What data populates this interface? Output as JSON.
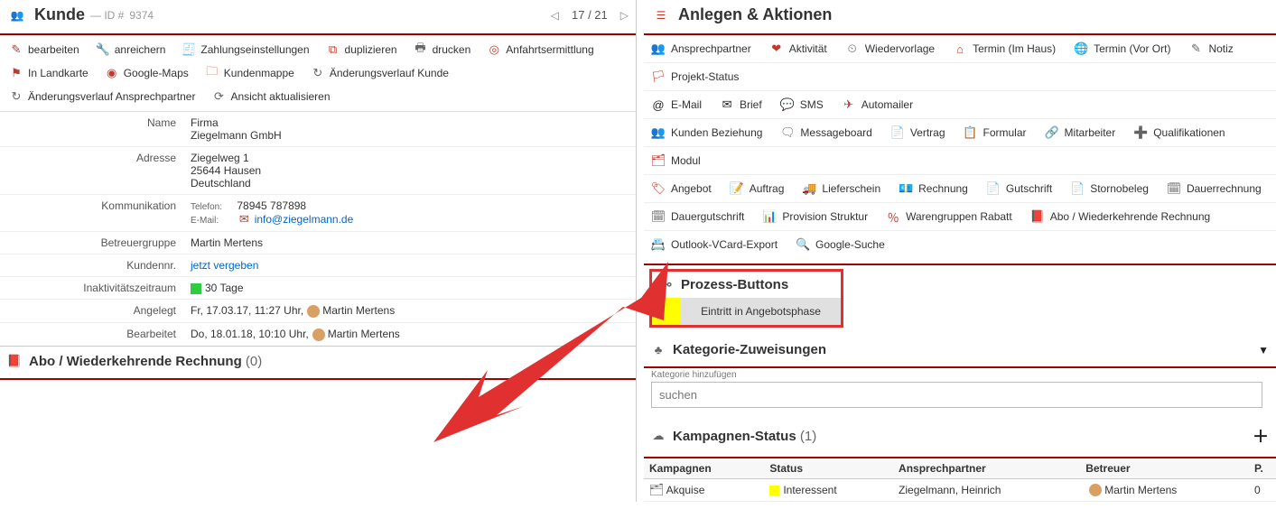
{
  "left": {
    "title": "Kunde",
    "id_prefix": "— ID #",
    "id": "9374",
    "pager": {
      "pos": "17 / 21"
    },
    "toolbar": [
      {
        "icon": "✎",
        "cls": "ic-red",
        "name": "edit",
        "label": "bearbeiten"
      },
      {
        "icon": "🔧",
        "cls": "ic-grey",
        "name": "enrich",
        "label": "anreichern"
      },
      {
        "icon": "🧾",
        "cls": "ic-red",
        "name": "payment-settings",
        "label": "Zahlungseinstellungen"
      },
      {
        "icon": "⧉",
        "cls": "ic-red",
        "name": "duplicate",
        "label": "duplizieren"
      },
      {
        "icon": "🖶",
        "cls": "ic-grey",
        "name": "print",
        "label": "drucken"
      },
      {
        "icon": "◎",
        "cls": "ic-red",
        "name": "route",
        "label": "Anfahrtsermittlung"
      },
      {
        "icon": "⚑",
        "cls": "ic-red",
        "name": "map",
        "label": "In Landkarte"
      },
      {
        "icon": "◉",
        "cls": "ic-red",
        "name": "gmaps",
        "label": "Google-Maps"
      },
      {
        "icon": "🗀",
        "cls": "ic-red",
        "name": "folder",
        "label": "Kundenmappe"
      },
      {
        "icon": "↻",
        "cls": "ic-grey",
        "name": "history-customer",
        "label": "Änderungsverlauf Kunde"
      },
      {
        "icon": "↻",
        "cls": "ic-grey",
        "name": "history-contact",
        "label": "Änderungsverlauf Ansprechpartner"
      },
      {
        "icon": "⟳",
        "cls": "ic-grey",
        "name": "refresh",
        "label": "Ansicht aktualisieren"
      }
    ],
    "fields": {
      "name_label": "Name",
      "name_line1": "Firma",
      "name_line2": "Ziegelmann GmbH",
      "addr_label": "Adresse",
      "addr_line1": "Ziegelweg 1",
      "addr_line2": "25644 Hausen",
      "addr_line3": "Deutschland",
      "comm_label": "Kommunikation",
      "phone_lbl": "Telefon:",
      "phone": "78945 787898",
      "email_lbl": "E-Mail:",
      "email": "info@ziegelmann.de",
      "group_label": "Betreuergruppe",
      "group": "Martin Mertens",
      "custno_label": "Kundennr.",
      "custno": "jetzt vergeben",
      "inact_label": "Inaktivitätszeitraum",
      "inact": "30 Tage",
      "created_label": "Angelegt",
      "created": "Fr, 17.03.17, 11:27 Uhr,",
      "created_by": "Martin Mertens",
      "edited_label": "Bearbeitet",
      "edited": "Do, 18.01.18, 10:10 Uhr,",
      "edited_by": "Martin Mertens"
    },
    "abo": {
      "title": "Abo / Wiederkehrende Rechnung",
      "count": "(0)"
    }
  },
  "right": {
    "title": "Anlegen & Aktionen",
    "row1": [
      {
        "icon": "👥",
        "cls": "ic-red",
        "name": "contact",
        "label": "Ansprechpartner"
      },
      {
        "icon": "❤",
        "cls": "ic-red",
        "name": "activity",
        "label": "Aktivität"
      },
      {
        "icon": "⏲",
        "cls": "ic-grey",
        "name": "resub",
        "label": "Wiedervorlage"
      },
      {
        "icon": "⌂",
        "cls": "ic-red",
        "name": "appt-inhouse",
        "label": "Termin (Im Haus)"
      },
      {
        "icon": "🌐",
        "cls": "ic-red",
        "name": "appt-onsite",
        "label": "Termin (Vor Ort)"
      },
      {
        "icon": "✎",
        "cls": "ic-grey",
        "name": "note",
        "label": "Notiz"
      }
    ],
    "row2": [
      {
        "icon": "🏳",
        "cls": "ic-red",
        "name": "project-status",
        "label": "Projekt-Status"
      }
    ],
    "row3": [
      {
        "icon": "@",
        "cls": "ic-dark",
        "name": "email",
        "label": "E-Mail"
      },
      {
        "icon": "✉",
        "cls": "ic-dark",
        "name": "letter",
        "label": "Brief"
      },
      {
        "icon": "💬",
        "cls": "ic-red",
        "name": "sms",
        "label": "SMS"
      },
      {
        "icon": "✈",
        "cls": "ic-red",
        "name": "automailer",
        "label": "Automailer"
      }
    ],
    "row4": [
      {
        "icon": "👥",
        "cls": "ic-red",
        "name": "relation",
        "label": "Kunden Beziehung"
      },
      {
        "icon": "🗨",
        "cls": "ic-grey",
        "name": "msgboard",
        "label": "Messageboard"
      },
      {
        "icon": "📄",
        "cls": "ic-red",
        "name": "contract",
        "label": "Vertrag"
      },
      {
        "icon": "📋",
        "cls": "ic-red",
        "name": "form",
        "label": "Formular"
      },
      {
        "icon": "🔗",
        "cls": "ic-green",
        "name": "employee",
        "label": "Mitarbeiter",
        "hl": true
      },
      {
        "icon": "➕",
        "cls": "ic-dark",
        "name": "qualif",
        "label": "Qualifikationen"
      }
    ],
    "row5": [
      {
        "icon": "🗂",
        "cls": "ic-red",
        "name": "module",
        "label": "Modul"
      }
    ],
    "row6": [
      {
        "icon": "🏷",
        "cls": "ic-red",
        "name": "offer",
        "label": "Angebot"
      },
      {
        "icon": "📝",
        "cls": "ic-red",
        "name": "order",
        "label": "Auftrag"
      },
      {
        "icon": "🚚",
        "cls": "ic-grey",
        "name": "delivery",
        "label": "Lieferschein"
      },
      {
        "icon": "💶",
        "cls": "ic-red",
        "name": "invoice",
        "label": "Rechnung"
      },
      {
        "icon": "📄",
        "cls": "ic-red",
        "name": "credit",
        "label": "Gutschrift"
      },
      {
        "icon": "📄",
        "cls": "ic-red",
        "name": "cancel",
        "label": "Stornobeleg"
      },
      {
        "icon": "🗓",
        "cls": "ic-grey",
        "name": "recurring",
        "label": "Dauerrechnung"
      }
    ],
    "row7": [
      {
        "icon": "🗓",
        "cls": "ic-grey",
        "name": "recurr-credit",
        "label": "Dauergutschrift"
      },
      {
        "icon": "📊",
        "cls": "ic-red",
        "name": "provision",
        "label": "Provision Struktur"
      },
      {
        "icon": "％",
        "cls": "ic-red",
        "name": "discount",
        "label": "Warengruppen Rabatt"
      },
      {
        "icon": "📕",
        "cls": "ic-red",
        "name": "abo",
        "label": "Abo / Wiederkehrende Rechnung"
      }
    ],
    "row8": [
      {
        "icon": "📇",
        "cls": "ic-red",
        "name": "vcard",
        "label": "Outlook-VCard-Export"
      },
      {
        "icon": "🔍",
        "cls": "ic-red",
        "name": "gsearch",
        "label": "Google-Suche"
      }
    ],
    "process": {
      "title": "Prozess-Buttons",
      "btn": "Eintritt in Angebotsphase"
    },
    "kategorie": {
      "title": "Kategorie-Zuweisungen",
      "add_label": "Kategorie hinzufügen",
      "placeholder": "suchen"
    },
    "kampagne": {
      "title": "Kampagnen-Status",
      "count": "(1)",
      "cols": {
        "c1": "Kampagnen",
        "c2": "Status",
        "c3": "Ansprechpartner",
        "c4": "Betreuer",
        "c5": "P."
      },
      "row": {
        "c1": "Akquise",
        "c2": "Interessent",
        "c3": "Ziegelmann, Heinrich",
        "c4": "Martin Mertens",
        "c5": "0"
      }
    }
  }
}
